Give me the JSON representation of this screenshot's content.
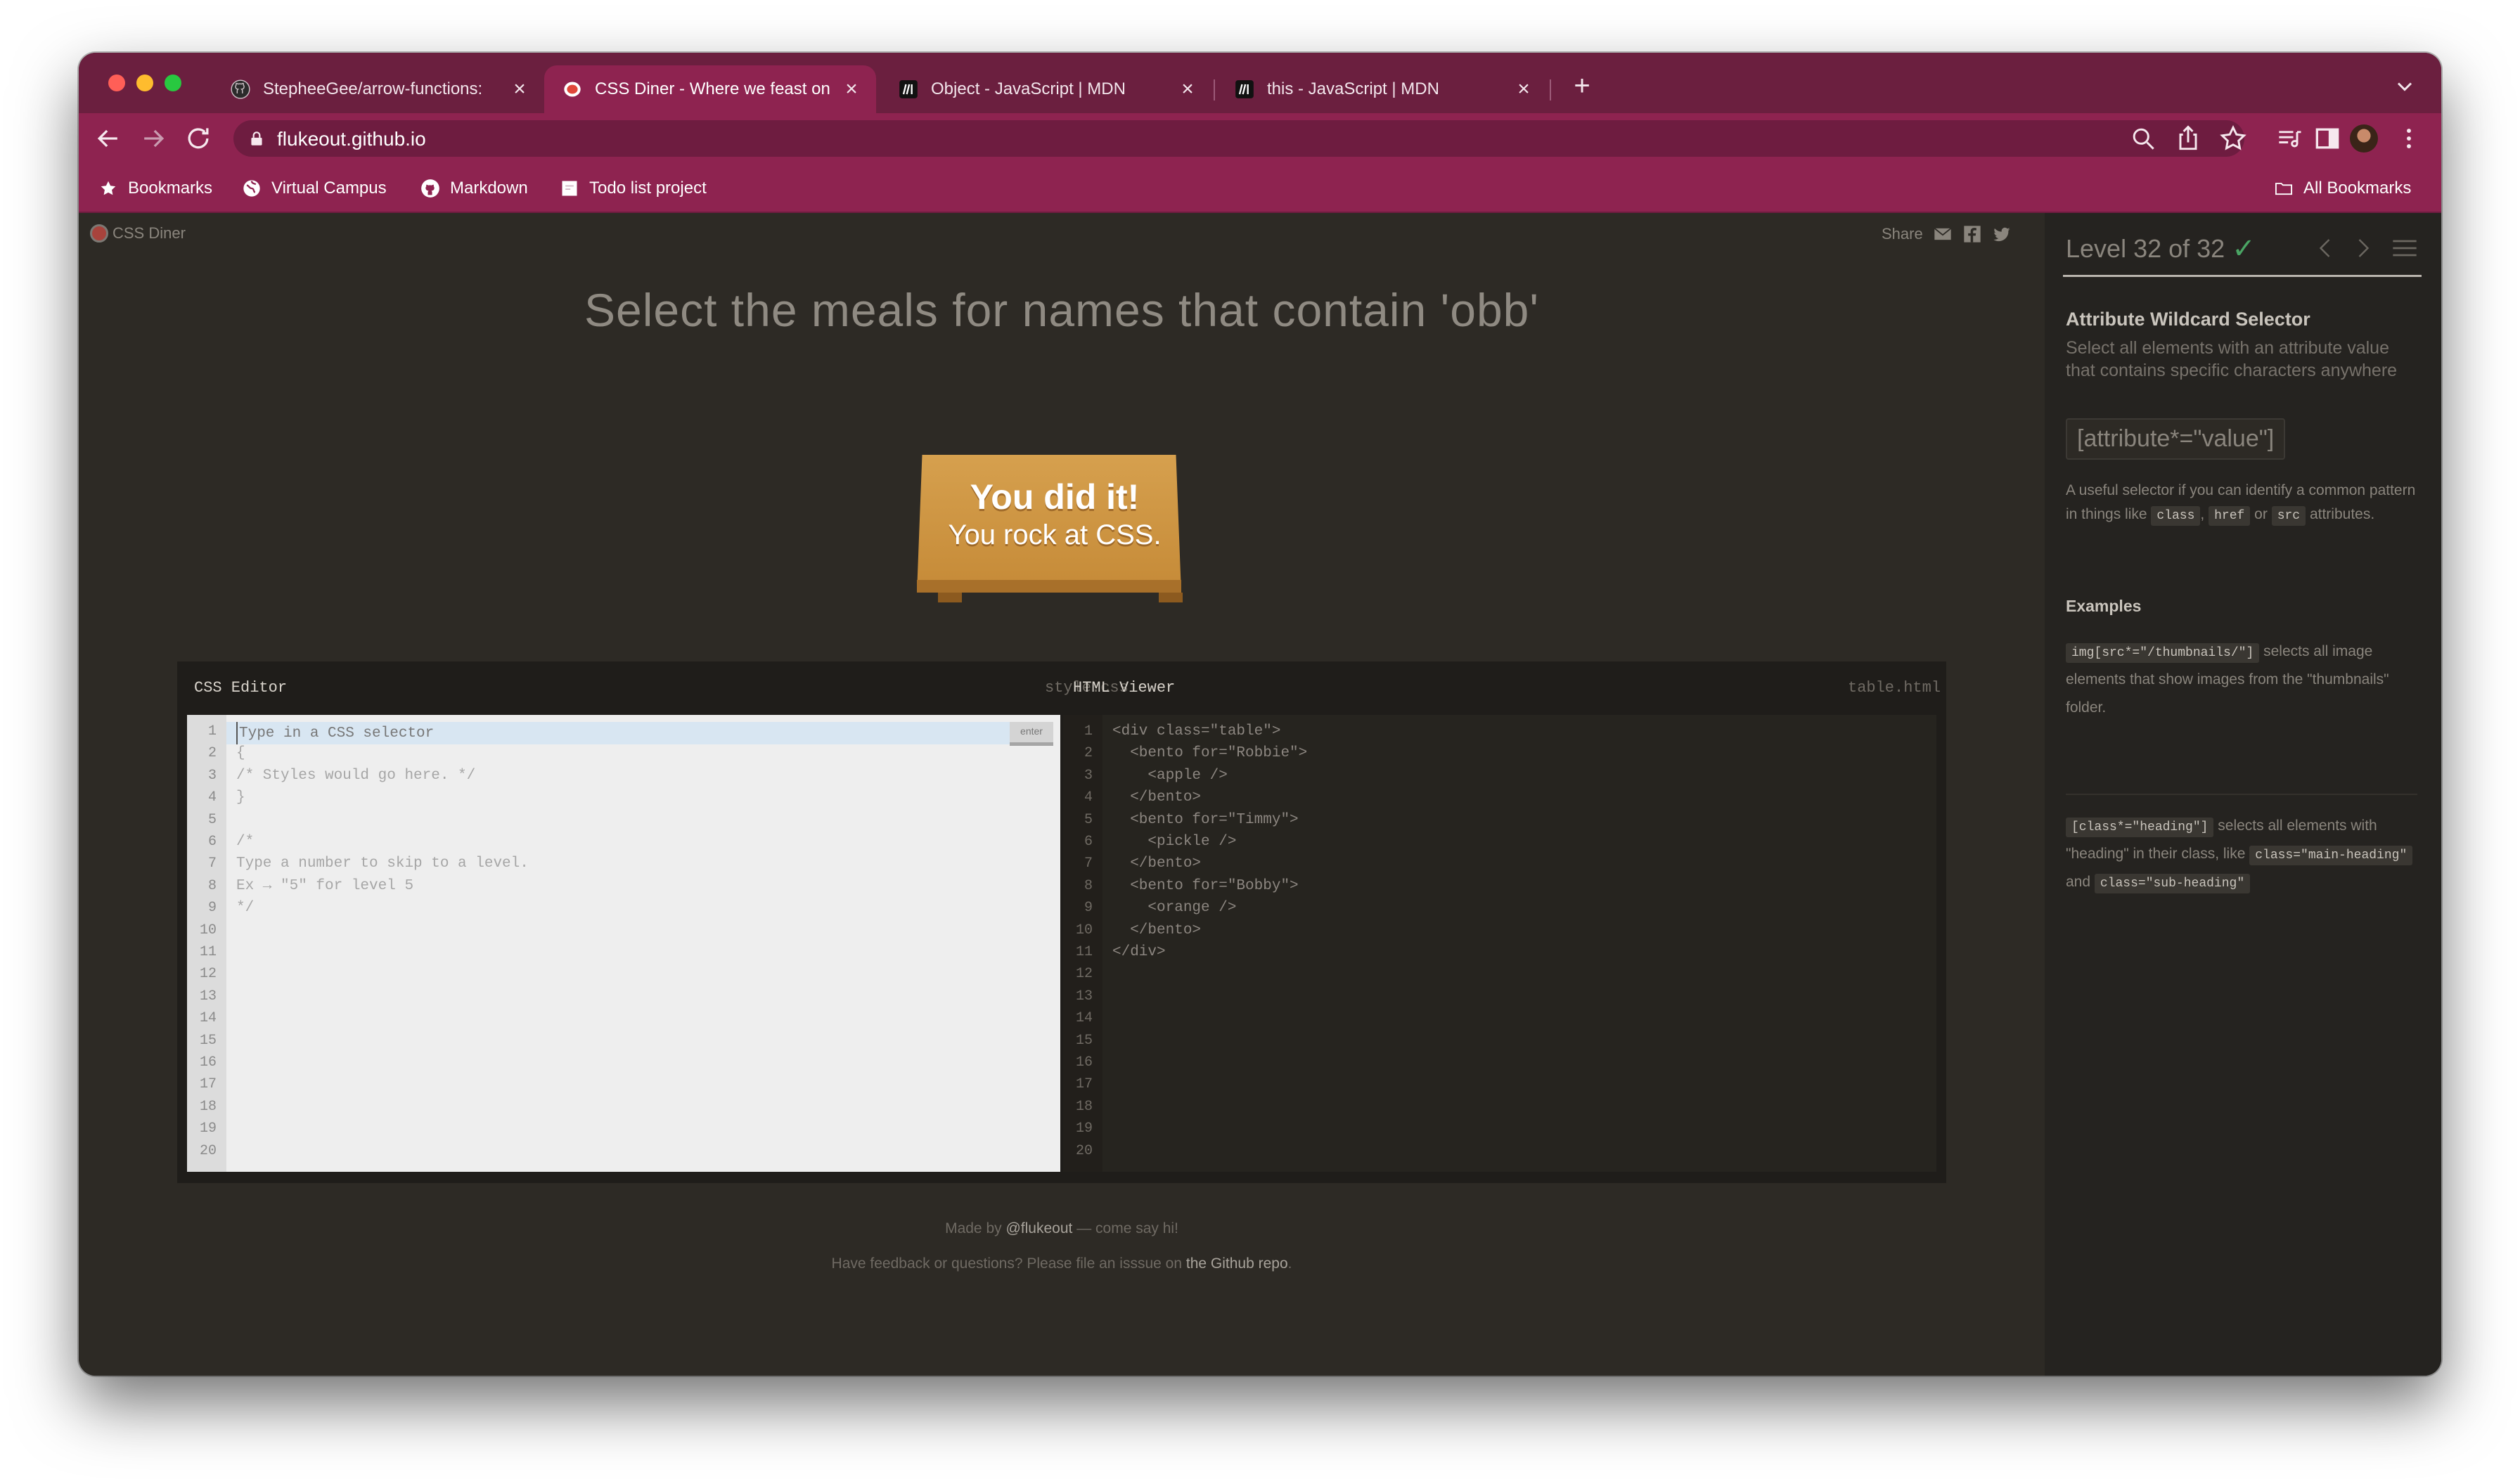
{
  "browser": {
    "tabs": [
      {
        "title": "StepheeGee/arrow-functions:",
        "icon": "github-icon",
        "active": false
      },
      {
        "title": "CSS Diner - Where we feast on",
        "icon": "css-diner-icon",
        "active": true
      },
      {
        "title": "Object - JavaScript | MDN",
        "icon": "mdn-icon",
        "active": false
      },
      {
        "title": "this - JavaScript | MDN",
        "icon": "mdn-icon",
        "active": false
      }
    ],
    "url": "flukeout.github.io",
    "bookmarks": [
      {
        "label": "Bookmarks",
        "icon": "star-icon"
      },
      {
        "label": "Virtual Campus",
        "icon": "globe-icon"
      },
      {
        "label": "Markdown",
        "icon": "github-icon"
      },
      {
        "label": "Todo list project",
        "icon": "page-icon"
      }
    ],
    "all_bookmarks": "All Bookmarks",
    "colors": {
      "tabstrip": "#6b1f3f",
      "toolbar": "#8e2350"
    }
  },
  "page": {
    "logo": "CSS Diner",
    "share_label": "Share",
    "order": "Select the meals for names that contain 'obb'",
    "success": {
      "line1": "You did it!",
      "line2": "You rock at CSS."
    },
    "css_editor": {
      "title": "CSS Editor",
      "file": "style.css",
      "placeholder": "Type in a CSS selector",
      "enter": "enter",
      "lines": [
        "{",
        "/* Styles would go here. */",
        "}",
        "",
        "/*",
        "Type a number to skip to a level.",
        "Ex → \"5\" for level 5",
        "*/"
      ]
    },
    "html_viewer": {
      "title": "HTML Viewer",
      "file": "table.html",
      "lines": [
        "<div class=\"table\">",
        "  <bento for=\"Robbie\">",
        "    <apple />",
        "  </bento>",
        "  <bento for=\"Timmy\">",
        "    <pickle />",
        "  </bento>",
        "  <bento for=\"Bobby\">",
        "    <orange />",
        "  </bento>",
        "</div>"
      ]
    },
    "line_numbers": [
      "1",
      "2",
      "3",
      "4",
      "5",
      "6",
      "7",
      "8",
      "9",
      "10",
      "11",
      "12",
      "13",
      "14",
      "15",
      "16",
      "17",
      "18",
      "19",
      "20"
    ],
    "footer": {
      "made_by": "Made by",
      "author": "@flukeout",
      "say_hi": "— come say hi!",
      "feedback": "Have feedback or questions? Please file an isssue on",
      "repo": "the Github repo",
      "period": "."
    }
  },
  "sidebar": {
    "level": "Level 32 of 32",
    "progress": 1.0,
    "title": "Attribute Wildcard Selector",
    "description": "Select all elements with an attribute value that contains specific characters anywhere",
    "syntax": "[attribute*=\"value\"]",
    "hint": {
      "pre": "A useful selector if you can identify a common pattern in things like",
      "code1": "class",
      "comma": ",",
      "code2": "href",
      "or": "or",
      "code3": "src",
      "post": "attributes."
    },
    "examples_title": "Examples",
    "examples": [
      {
        "code": "img[src*=\"/thumbnails/\"]",
        "text": "selects all image elements that show images from the \"thumbnails\" folder."
      },
      {
        "code": "[class*=\"heading\"]",
        "text": "selects all elements with \"heading\" in their class, like",
        "code2": "class=\"main-heading\"",
        "and": "and",
        "code3": "class=\"sub-heading\""
      }
    ]
  }
}
